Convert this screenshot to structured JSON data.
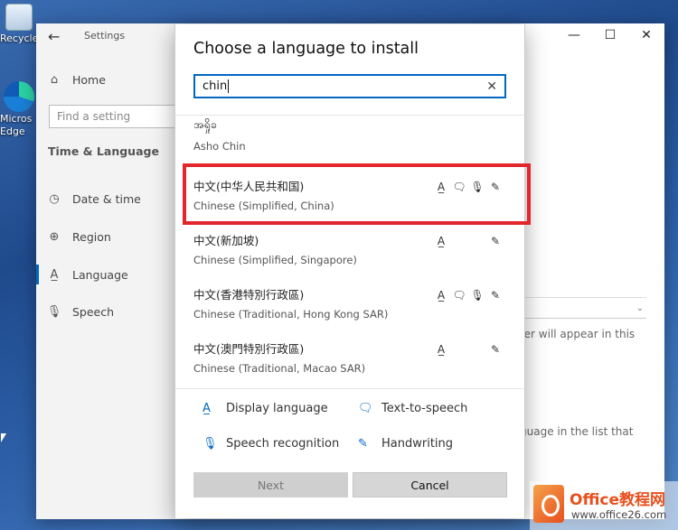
{
  "desktop": {
    "icons": [
      {
        "label": "Recycle"
      },
      {
        "label_line1": "Micros",
        "label_line2": "Edge"
      }
    ]
  },
  "settings": {
    "back_glyph": "←",
    "title": "Settings",
    "home_label": "Home",
    "search_placeholder": "Find a setting",
    "section_title": "Time & Language",
    "nav": {
      "date_time": "Date & time",
      "region": "Region",
      "language": "Language",
      "speech": "Speech"
    },
    "window_controls": {
      "minimize": "—",
      "maximize": "☐",
      "close": "✕"
    },
    "background_text_1": "rer will appear in this",
    "background_text_2": "guage in the list that"
  },
  "dialog": {
    "title": "Choose a language to install",
    "search_value": "chin",
    "clear_glyph": "✕",
    "languages": [
      {
        "native": "အရှိုခ",
        "english": "Asho Chin",
        "features": []
      },
      {
        "native": "中文(中华人民共和国)",
        "english": "Chinese (Simplified, China)",
        "features": [
          "display",
          "tts",
          "speech",
          "handwriting"
        ]
      },
      {
        "native": "中文(新加坡)",
        "english": "Chinese (Simplified, Singapore)",
        "features": [
          "display",
          "handwriting"
        ]
      },
      {
        "native": "中文(香港特別行政區)",
        "english": "Chinese (Traditional, Hong Kong SAR)",
        "features": [
          "display",
          "tts",
          "speech",
          "handwriting"
        ]
      },
      {
        "native": "中文(澳門特別行政區)",
        "english": "Chinese (Traditional, Macao SAR)",
        "features": [
          "display",
          "handwriting"
        ]
      }
    ],
    "legend": {
      "display": "Display language",
      "tts": "Text-to-speech",
      "speech": "Speech recognition",
      "handwriting": "Handwriting"
    },
    "buttons": {
      "next": "Next",
      "cancel": "Cancel"
    }
  },
  "icons": {
    "display": "A̲",
    "tts": "🗨",
    "speech": "🎙",
    "handwriting": "✎"
  },
  "colors": {
    "accent": "#0067c0",
    "highlight": "#e2262c"
  },
  "watermark": {
    "brand": "Office教程网",
    "url": "www.office26.com"
  }
}
